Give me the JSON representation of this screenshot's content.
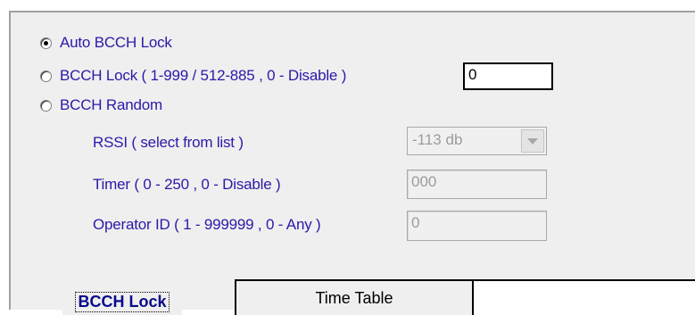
{
  "options": [
    {
      "label": "Auto BCCH Lock",
      "checked": true
    },
    {
      "label": "BCCH Lock  ( 1-999 / 512-885 ,  0 - Disable )",
      "checked": false
    },
    {
      "label": "BCCH Random",
      "checked": false
    }
  ],
  "bcch_lock_input": {
    "value": "0"
  },
  "rssi": {
    "label": "RSSI ( select from list )",
    "value": "-113 db"
  },
  "timer": {
    "label": "Timer ( 0 - 250  , 0 - Disable )",
    "value": "000"
  },
  "operator": {
    "label": "Operator ID ( 1 -  999999 ,  0 - Any  )",
    "value": "0"
  },
  "tabs": [
    {
      "label": "BCCH Lock"
    },
    {
      "label": "Time Table"
    }
  ],
  "icons": {
    "dropdown": "chevron-down-icon"
  }
}
